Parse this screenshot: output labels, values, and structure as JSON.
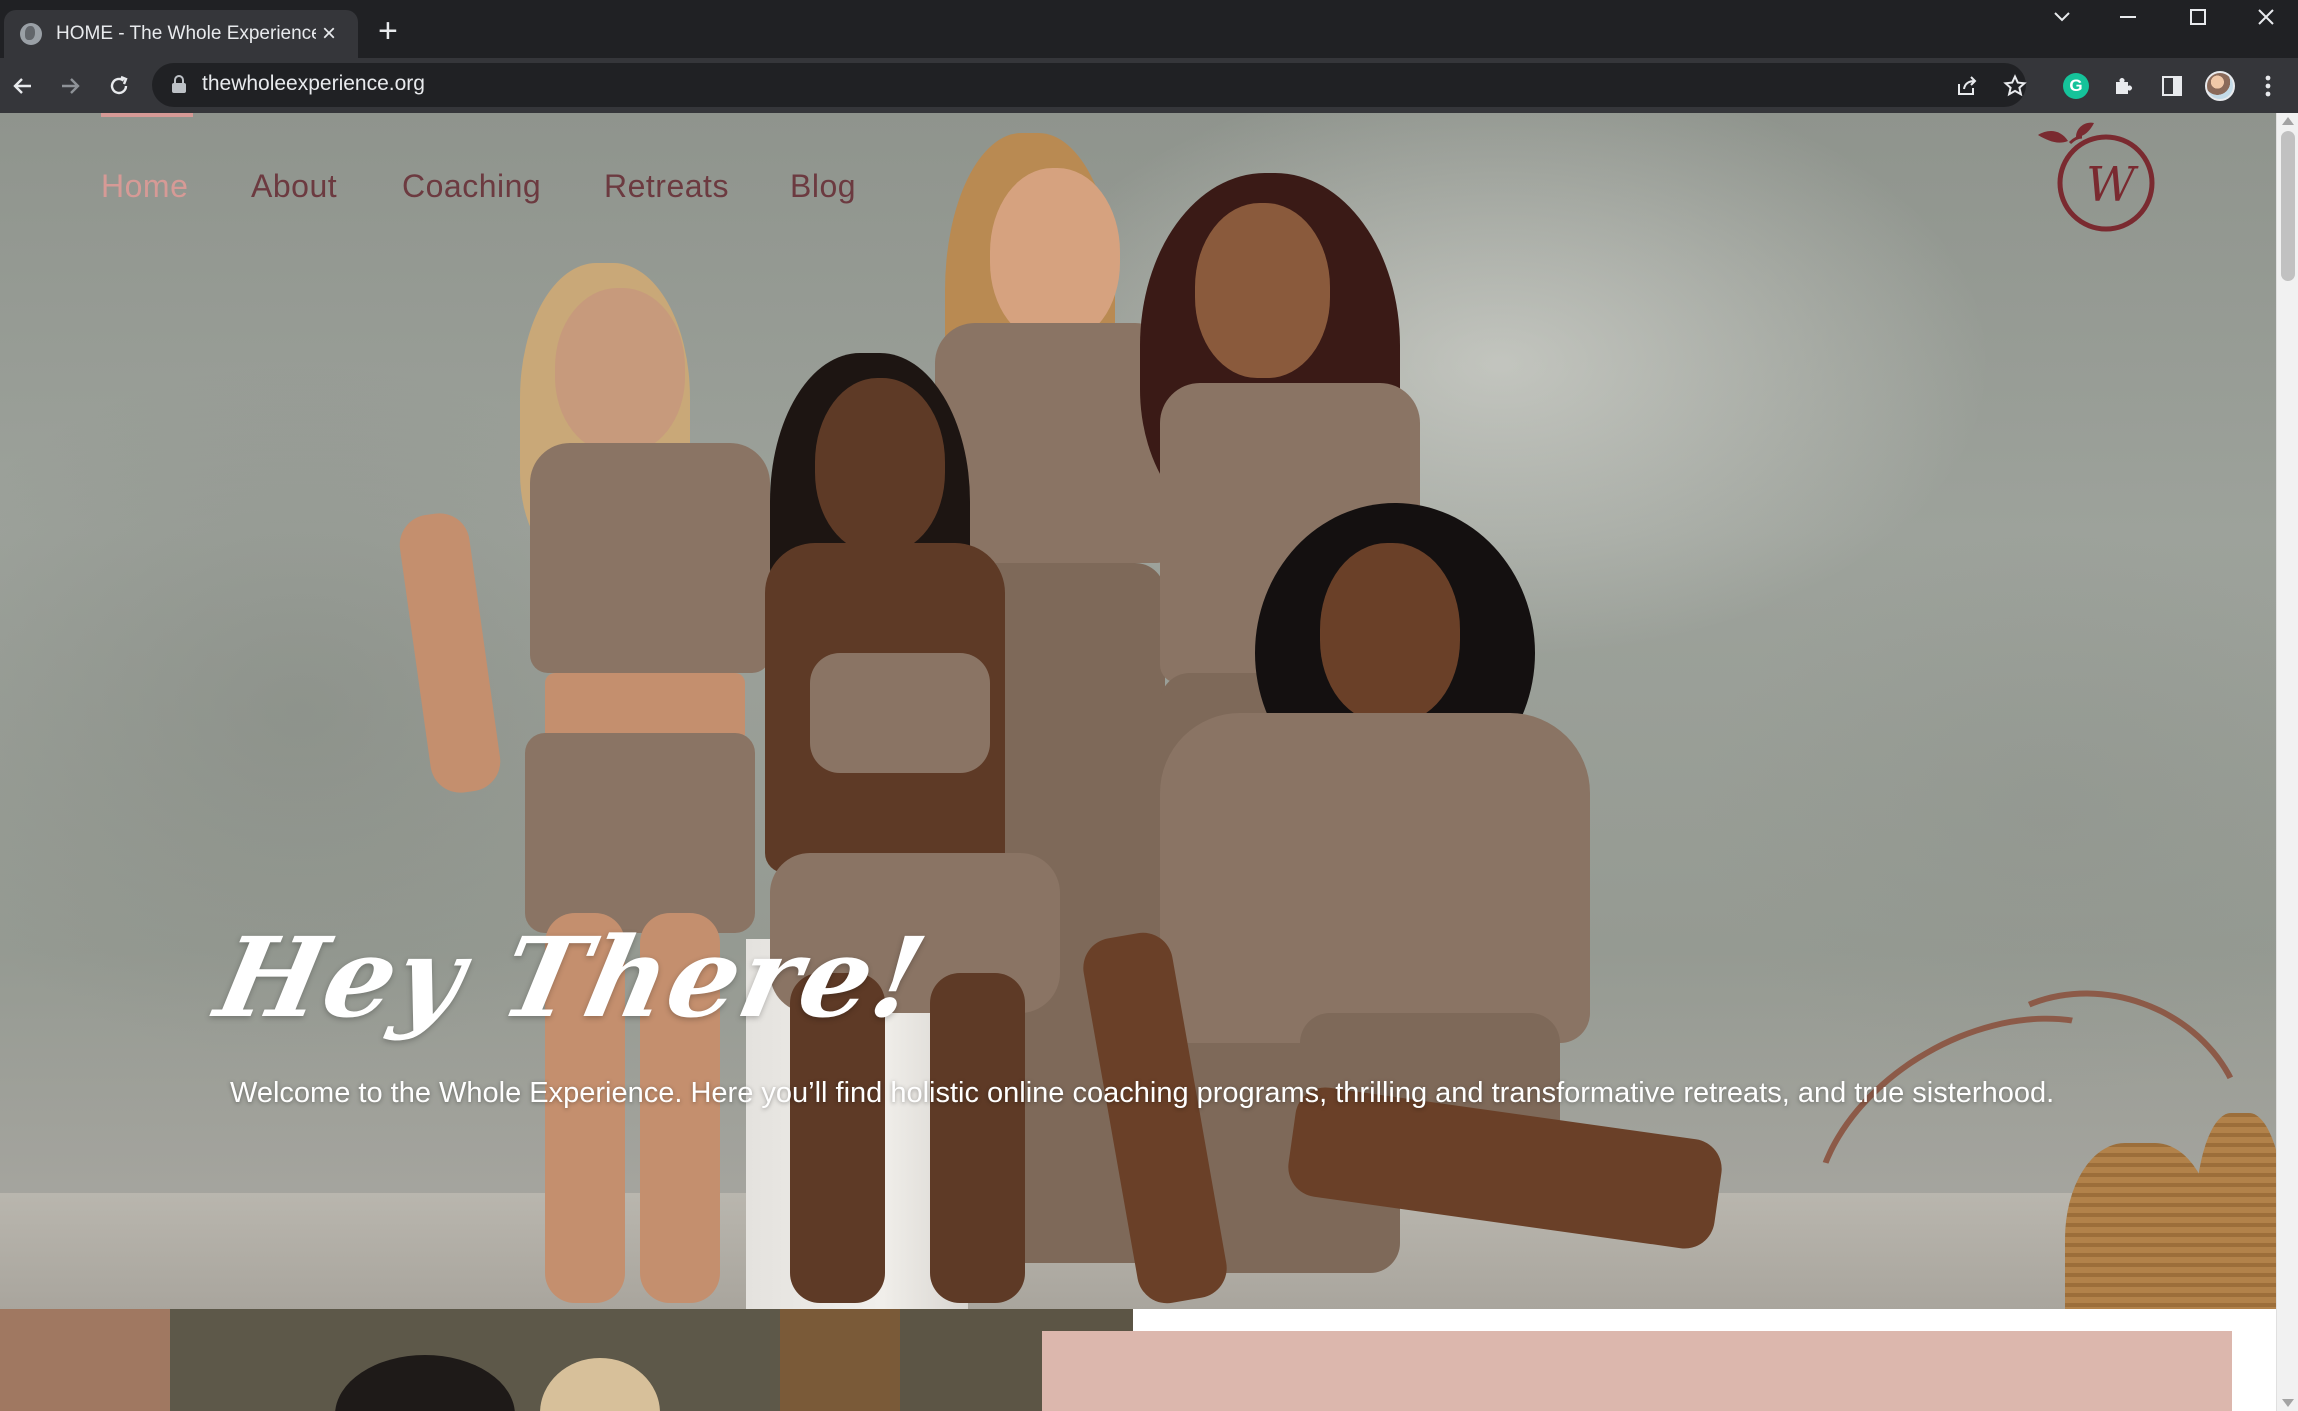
{
  "browser": {
    "tab_title": "HOME - The Whole Experience",
    "url": "thewholeexperience.org",
    "icons": {
      "back": "arrow-left-icon",
      "forward": "arrow-right-icon",
      "reload": "reload-icon",
      "share": "share-icon",
      "bookmark": "star-icon",
      "grammarly": "grammarly-icon",
      "extensions": "puzzle-icon",
      "side_panel": "side-panel-icon",
      "profile": "avatar-icon",
      "menu": "kebab-menu-icon"
    },
    "grammarly_letter": "G"
  },
  "site": {
    "nav": [
      {
        "label": "Home",
        "active": true
      },
      {
        "label": "About",
        "active": false
      },
      {
        "label": "Coaching",
        "active": false
      },
      {
        "label": "Retreats",
        "active": false
      },
      {
        "label": "Blog",
        "active": false
      }
    ],
    "logo_letter": "W",
    "hero": {
      "title": "Hey There!",
      "text": "Welcome to the Whole Experience. Here you’ll find holistic online coaching programs, thrilling and transformative retreats, and true sisterhood."
    },
    "colors": {
      "nav_text": "#6c3a40",
      "nav_active": "#d69a96",
      "logo": "#7a2a30",
      "card": "#dcb7ad"
    }
  }
}
